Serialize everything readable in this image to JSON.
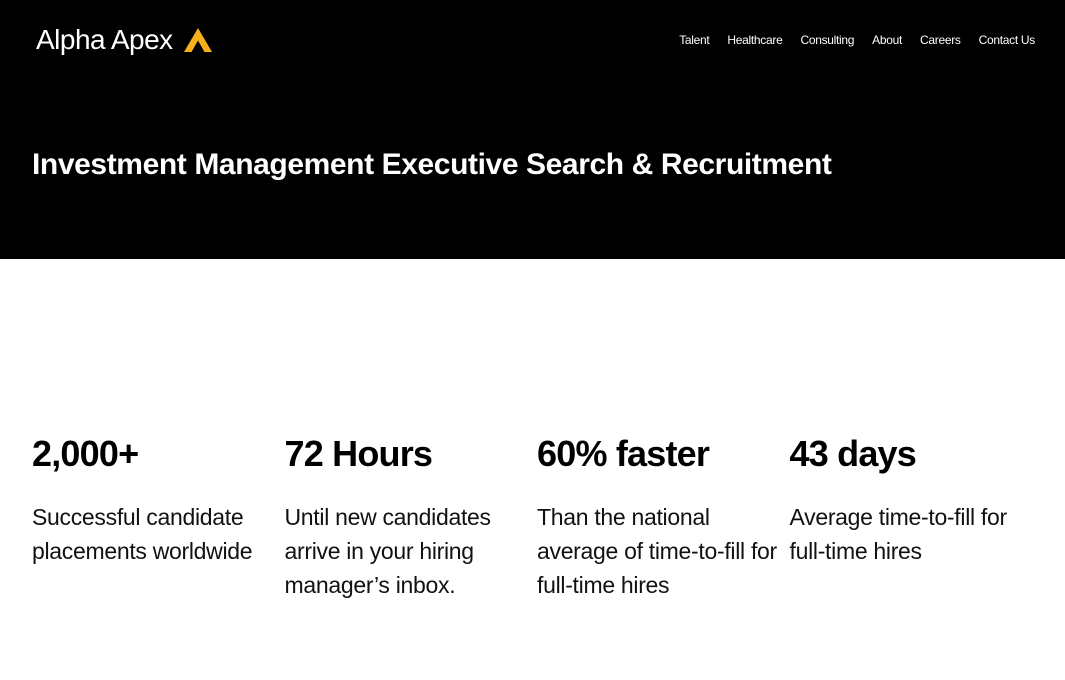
{
  "header": {
    "logo_text": "Alpha Apex",
    "logo_icon": "apex-triangle-icon",
    "accent_color": "#F5B01A",
    "nav": [
      {
        "label": "Talent"
      },
      {
        "label": "Healthcare"
      },
      {
        "label": "Consulting"
      },
      {
        "label": "About"
      },
      {
        "label": "Careers"
      },
      {
        "label": "Contact Us"
      }
    ]
  },
  "hero": {
    "title": "Investment Management Executive Search & Recruitment"
  },
  "stats": [
    {
      "value": "2,000+",
      "description": "Successful candidate placements worldwide"
    },
    {
      "value": "72 Hours",
      "description": "Until new candidates arrive in your hiring manager’s inbox."
    },
    {
      "value": "60% faster",
      "description": "Than the national average of time-to-fill for full-time hires"
    },
    {
      "value": "43 days",
      "description": "Average time-to-fill for full-time hires"
    }
  ]
}
